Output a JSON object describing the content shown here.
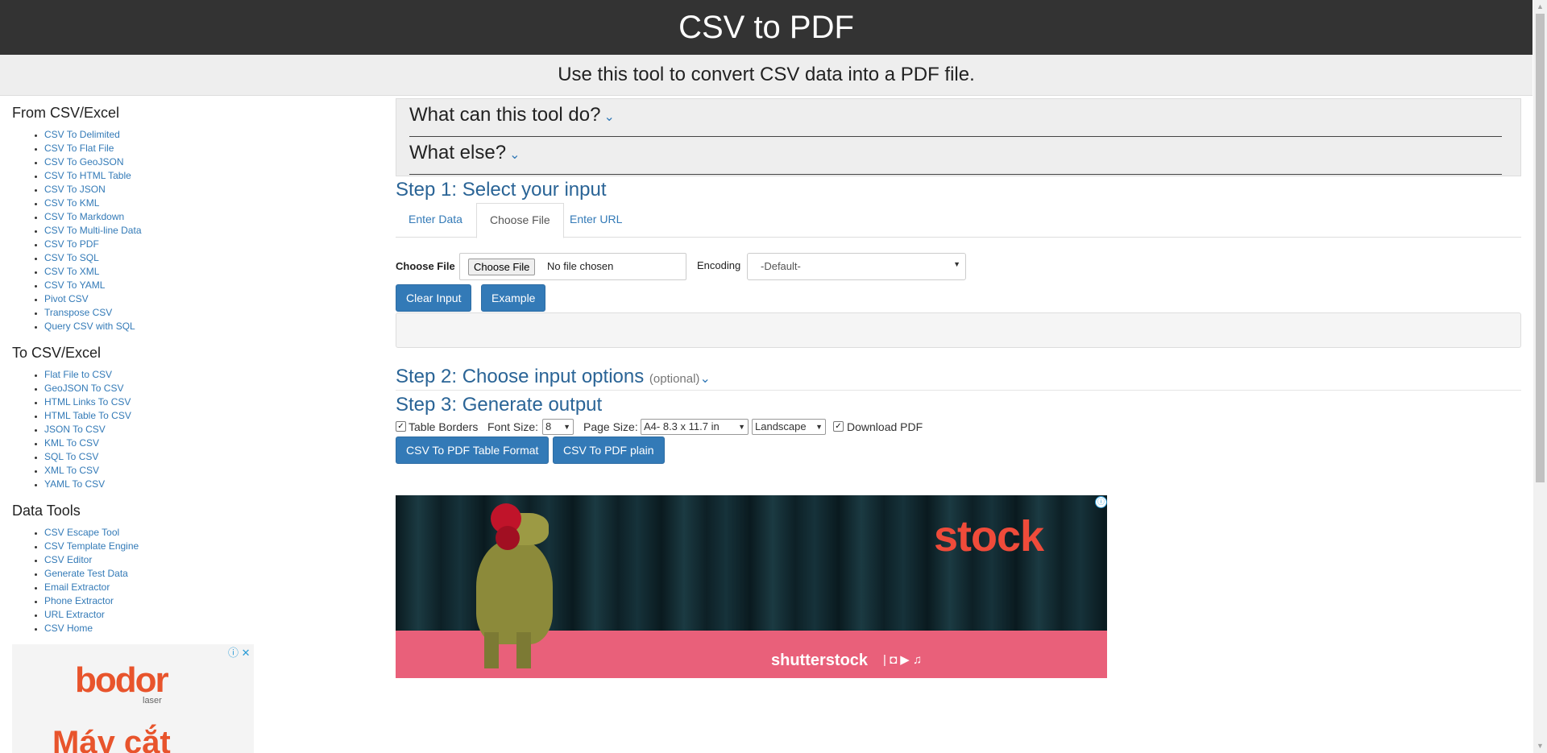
{
  "header": {
    "title": "CSV to PDF",
    "subtitle": "Use this tool to convert CSV data into a PDF file."
  },
  "sidebar": {
    "sections": [
      {
        "heading": "From CSV/Excel",
        "items": [
          "CSV To Delimited",
          "CSV To Flat File",
          "CSV To GeoJSON",
          "CSV To HTML Table",
          "CSV To JSON",
          "CSV To KML",
          "CSV To Markdown",
          "CSV To Multi-line Data",
          "CSV To PDF",
          "CSV To SQL",
          "CSV To XML",
          "CSV To YAML",
          "Pivot CSV",
          "Transpose CSV",
          "Query CSV with SQL"
        ]
      },
      {
        "heading": "To CSV/Excel",
        "items": [
          "Flat File to CSV",
          "GeoJSON To CSV",
          "HTML Links To CSV",
          "HTML Table To CSV",
          "JSON To CSV",
          "KML To CSV",
          "SQL To CSV",
          "XML To CSV",
          "YAML To CSV"
        ]
      },
      {
        "heading": "Data Tools",
        "items": [
          "CSV Escape Tool",
          "CSV Template Engine",
          "CSV Editor",
          "Generate Test Data",
          "Email Extractor",
          "Phone Extractor",
          "URL Extractor",
          "CSV Home"
        ]
      }
    ],
    "ad": {
      "brand": "bodor",
      "brand_sub": "laser",
      "text": "Máy cắt",
      "icons": "ⓘ ✕"
    }
  },
  "faq": {
    "q1": "What can this tool do?",
    "q2": "What else?",
    "chevron": "⌄"
  },
  "step1": {
    "title": "Step 1: Select your input",
    "tabs": [
      "Enter Data",
      "Choose File",
      "Enter URL"
    ],
    "active_tab": "Choose File",
    "file_label": "Choose File",
    "file_button": "Choose File",
    "file_status": "No file chosen",
    "encoding_label": "Encoding",
    "encoding_value": "-Default-",
    "clear_button": "Clear Input",
    "example_button": "Example"
  },
  "step2": {
    "title": "Step 2: Choose input options",
    "optional": "(optional)"
  },
  "step3": {
    "title": "Step 3: Generate output",
    "table_borders_label": "Table Borders",
    "table_borders_checked": true,
    "font_size_label": "Font Size:",
    "font_size_value": "8",
    "page_size_label": "Page Size:",
    "page_size_value": "A4- 8.3 x 11.7 in",
    "orientation_value": "Landscape",
    "download_label": "Download PDF",
    "download_checked": true,
    "btn_table": "CSV To PDF Table Format",
    "btn_plain": "CSV To PDF plain"
  },
  "ad_banner": {
    "brand": "stock",
    "footer_brand": "shutterstock",
    "footer_icons": "| ◘ ▶ ♫",
    "info_icon": "ⓘ"
  },
  "colors": {
    "header_bg": "#333333",
    "link": "#337ab7",
    "button": "#337ab7",
    "step_title": "#2a6496"
  }
}
